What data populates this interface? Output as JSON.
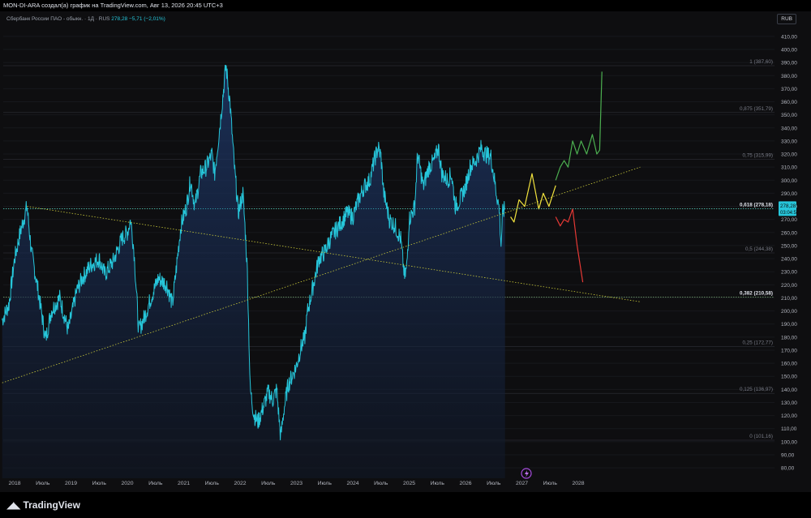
{
  "header": {
    "text": "MON-DI-ARA создал(а) график на TradingView.com, Авг 13, 2026 20:45 UTC+3"
  },
  "legend": {
    "symbol": "Сбербанк России ПАО - обыкн. · 1Д · RUS",
    "price": "278,28",
    "change": "−5,71 (−2,01%)"
  },
  "currency": "RUB",
  "footer": {
    "logo_text": "TradingView"
  },
  "price_label": {
    "value": "278,28",
    "timer": "03:04:57"
  },
  "chart_data": {
    "type": "area",
    "ylim": [
      72,
      418
    ],
    "y_ticks": [
      80,
      90,
      100,
      110,
      120,
      130,
      140,
      150,
      160,
      170,
      180,
      190,
      200,
      210,
      220,
      230,
      240,
      250,
      260,
      270,
      280,
      290,
      300,
      310,
      320,
      330,
      340,
      350,
      360,
      370,
      380,
      390,
      400,
      410
    ],
    "x_ticks": [
      {
        "label": "2018",
        "t": 2018.0
      },
      {
        "label": "Июль",
        "t": 2018.5
      },
      {
        "label": "2019",
        "t": 2019.0
      },
      {
        "label": "Июль",
        "t": 2019.5
      },
      {
        "label": "2020",
        "t": 2020.0
      },
      {
        "label": "Июль",
        "t": 2020.5
      },
      {
        "label": "2021",
        "t": 2021.0
      },
      {
        "label": "Июль",
        "t": 2021.5
      },
      {
        "label": "2022",
        "t": 2022.0
      },
      {
        "label": "Июль",
        "t": 2022.5
      },
      {
        "label": "2023",
        "t": 2023.0
      },
      {
        "label": "Июль",
        "t": 2023.5
      },
      {
        "label": "2024",
        "t": 2024.0
      },
      {
        "label": "Июль",
        "t": 2024.5
      },
      {
        "label": "2025",
        "t": 2025.0
      },
      {
        "label": "Июль",
        "t": 2025.5
      },
      {
        "label": "2026",
        "t": 2026.0
      },
      {
        "label": "Июль",
        "t": 2026.5
      },
      {
        "label": "2027",
        "t": 2027.0
      },
      {
        "label": "Июль",
        "t": 2027.5
      },
      {
        "label": "2028",
        "t": 2028.0
      }
    ],
    "series": [
      {
        "color": "#26c6da",
        "points": [
          [
            2017.78,
            193
          ],
          [
            2017.9,
            205
          ],
          [
            2018.0,
            240
          ],
          [
            2018.1,
            260
          ],
          [
            2018.22,
            280
          ],
          [
            2018.3,
            245
          ],
          [
            2018.42,
            215
          ],
          [
            2018.55,
            178
          ],
          [
            2018.65,
            200
          ],
          [
            2018.8,
            210
          ],
          [
            2018.95,
            185
          ],
          [
            2019.1,
            215
          ],
          [
            2019.2,
            225
          ],
          [
            2019.35,
            235
          ],
          [
            2019.5,
            240
          ],
          [
            2019.6,
            228
          ],
          [
            2019.75,
            238
          ],
          [
            2019.9,
            255
          ],
          [
            2020.0,
            260
          ],
          [
            2020.06,
            270
          ],
          [
            2020.12,
            245
          ],
          [
            2020.2,
            185
          ],
          [
            2020.3,
            195
          ],
          [
            2020.42,
            210
          ],
          [
            2020.55,
            225
          ],
          [
            2020.7,
            220
          ],
          [
            2020.8,
            205
          ],
          [
            2020.95,
            265
          ],
          [
            2021.05,
            280
          ],
          [
            2021.12,
            300
          ],
          [
            2021.2,
            280
          ],
          [
            2021.3,
            305
          ],
          [
            2021.4,
            310
          ],
          [
            2021.5,
            320
          ],
          [
            2021.55,
            305
          ],
          [
            2021.65,
            345
          ],
          [
            2021.75,
            388
          ],
          [
            2021.82,
            360
          ],
          [
            2021.9,
            310
          ],
          [
            2021.97,
            275
          ],
          [
            2022.05,
            290
          ],
          [
            2022.1,
            255
          ],
          [
            2022.13,
            230
          ],
          [
            2022.18,
            140
          ],
          [
            2022.25,
            120
          ],
          [
            2022.32,
            115
          ],
          [
            2022.4,
            125
          ],
          [
            2022.5,
            138
          ],
          [
            2022.58,
            132
          ],
          [
            2022.65,
            140
          ],
          [
            2022.72,
            103
          ],
          [
            2022.78,
            125
          ],
          [
            2022.85,
            143
          ],
          [
            2022.92,
            150
          ],
          [
            2023.0,
            158
          ],
          [
            2023.08,
            172
          ],
          [
            2023.15,
            180
          ],
          [
            2023.2,
            200
          ],
          [
            2023.3,
            220
          ],
          [
            2023.4,
            240
          ],
          [
            2023.5,
            245
          ],
          [
            2023.6,
            255
          ],
          [
            2023.7,
            262
          ],
          [
            2023.8,
            268
          ],
          [
            2023.9,
            275
          ],
          [
            2024.0,
            272
          ],
          [
            2024.1,
            285
          ],
          [
            2024.2,
            295
          ],
          [
            2024.3,
            300
          ],
          [
            2024.38,
            315
          ],
          [
            2024.45,
            325
          ],
          [
            2024.5,
            318
          ],
          [
            2024.55,
            290
          ],
          [
            2024.65,
            270
          ],
          [
            2024.75,
            265
          ],
          [
            2024.85,
            255
          ],
          [
            2024.92,
            225
          ],
          [
            2024.96,
            235
          ],
          [
            2025.0,
            270
          ],
          [
            2025.1,
            280
          ],
          [
            2025.15,
            320
          ],
          [
            2025.25,
            295
          ],
          [
            2025.35,
            310
          ],
          [
            2025.45,
            315
          ],
          [
            2025.52,
            325
          ],
          [
            2025.58,
            305
          ],
          [
            2025.68,
            300
          ],
          [
            2025.75,
            305
          ],
          [
            2025.82,
            280
          ],
          [
            2025.9,
            285
          ],
          [
            2026.0,
            295
          ],
          [
            2026.08,
            310
          ],
          [
            2026.18,
            315
          ],
          [
            2026.28,
            325
          ],
          [
            2026.35,
            320
          ],
          [
            2026.45,
            318
          ],
          [
            2026.55,
            290
          ],
          [
            2026.6,
            278
          ],
          [
            2026.63,
            250
          ],
          [
            2026.66,
            275
          ],
          [
            2026.7,
            278.28
          ]
        ]
      }
    ],
    "projections": [
      {
        "color": "#f2e33d",
        "points": [
          [
            2026.8,
            272
          ],
          [
            2026.86,
            268
          ],
          [
            2026.95,
            285
          ],
          [
            2027.05,
            280
          ],
          [
            2027.18,
            305
          ],
          [
            2027.3,
            278
          ],
          [
            2027.38,
            290
          ],
          [
            2027.48,
            280
          ],
          [
            2027.6,
            296
          ]
        ]
      },
      {
        "color": "#4caf50",
        "points": [
          [
            2027.6,
            300
          ],
          [
            2027.68,
            310
          ],
          [
            2027.75,
            315
          ],
          [
            2027.82,
            310
          ],
          [
            2027.9,
            330
          ],
          [
            2027.98,
            320
          ],
          [
            2028.05,
            330
          ],
          [
            2028.15,
            320
          ],
          [
            2028.25,
            335
          ],
          [
            2028.33,
            320
          ],
          [
            2028.38,
            323
          ],
          [
            2028.42,
            383
          ]
        ]
      },
      {
        "color": "#e53935",
        "points": [
          [
            2027.6,
            272
          ],
          [
            2027.68,
            265
          ],
          [
            2027.75,
            270
          ],
          [
            2027.82,
            268
          ],
          [
            2027.9,
            278
          ],
          [
            2027.98,
            250
          ],
          [
            2028.08,
            222
          ]
        ]
      }
    ],
    "trendlines": [
      {
        "color": "#c9c93a",
        "points": [
          [
            2017.78,
            145
          ],
          [
            2029.1,
            310
          ]
        ]
      },
      {
        "color": "#c9c93a",
        "points": [
          [
            2018.22,
            280
          ],
          [
            2029.1,
            207
          ]
        ]
      }
    ],
    "fib_levels": [
      {
        "ratio": "1",
        "value": 387.6,
        "label": "1 (387,60)",
        "bold": false
      },
      {
        "ratio": "0.875",
        "value": 351.79,
        "label": "0,875 (351,79)",
        "bold": false
      },
      {
        "ratio": "0.75",
        "value": 315.99,
        "label": "0,75 (315,99)",
        "bold": false
      },
      {
        "ratio": "0.618",
        "value": 278.18,
        "label": "0,618 (278,18)",
        "bold": true
      },
      {
        "ratio": "0.5",
        "value": 244.38,
        "label": "0,5 (244,38)",
        "bold": false
      },
      {
        "ratio": "0.382",
        "value": 210.58,
        "label": "0,382 (210,58)",
        "bold": true
      },
      {
        "ratio": "0.25",
        "value": 172.77,
        "label": "0,25 (172,77)",
        "bold": false
      },
      {
        "ratio": "0.125",
        "value": 136.97,
        "label": "0,125 (136,97)",
        "bold": false
      },
      {
        "ratio": "0",
        "value": 101.16,
        "label": "0 (101,16)",
        "bold": false
      }
    ],
    "last_price": 278.28
  }
}
